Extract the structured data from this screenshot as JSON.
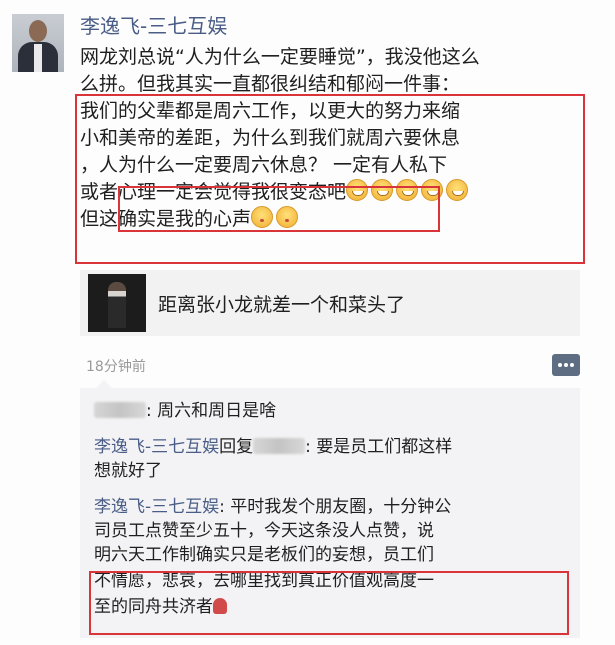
{
  "post": {
    "author": "李逸飞-三七互娱",
    "text_lines": [
      "网龙刘总说“人为什么一定要睡觉”，我没他这么",
      "么拼。但我其实一直都很纠结和郁闷一件事：",
      "我们的父辈都是周六工作，以更大的努力来缩",
      "小和美帝的差距，为什么到我们就周六要休息",
      "，人为什么一定要周六休息？  一定有人私下",
      "或者心理一定会觉得我很变态吧",
      "但这确实是我的心声"
    ],
    "emoji_grin": "grinning-emoji",
    "emoji_kiss": "kissing-emoji"
  },
  "link_card": {
    "title": "距离张小龙就差一个和菜头了",
    "thumb_icon": "person-photo-thumbnail"
  },
  "time_ago": "18分钟前",
  "comment_button_icon": "comment-dots-icon",
  "comments": [
    {
      "name": "",
      "text": ": 周六和周日是啥"
    },
    {
      "name": "李逸飞-三七互娱",
      "reply_word": "回复",
      "text": ": 要是员工们都这样",
      "text2": "想就好了"
    },
    {
      "name": "李逸飞-三七互娱",
      "text": ": 平时我发个朋友圈，十分钟公",
      "text2": "司员工点赞至少五十，今天这条没人点赞，说",
      "text3": "明六天工作制确实只是老板们的妄想，员工们",
      "text4": "不情愿，悲哀，去哪里找到真正价值观高度一",
      "text5": "至的同舟共济者"
    }
  ],
  "colors": {
    "name": "#4a5d86",
    "highlight": "#d8343a",
    "comment_bg": "#f3f3f5"
  }
}
